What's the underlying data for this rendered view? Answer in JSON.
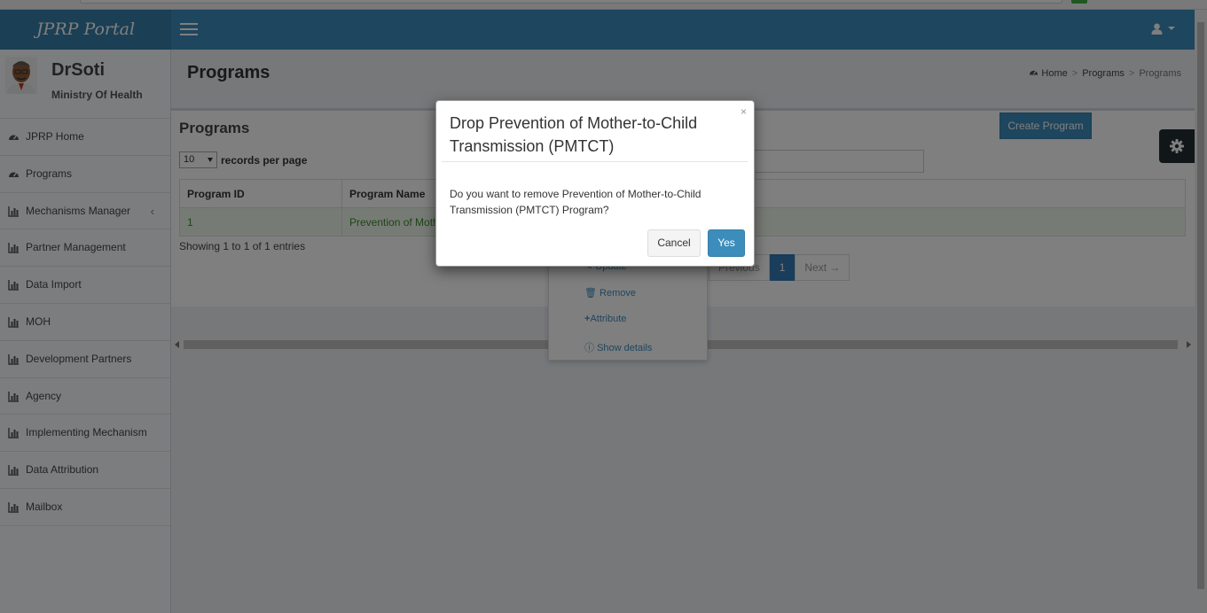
{
  "app": {
    "title": "JPRP Portal"
  },
  "user": {
    "name": "DrSoti",
    "org": "Ministry Of Health"
  },
  "sidebar": {
    "items": [
      {
        "label": "JPRP Home",
        "icon": "dashboard-icon"
      },
      {
        "label": "Programs",
        "icon": "dashboard-icon"
      },
      {
        "label": "Mechanisms Manager",
        "icon": "bar-chart-icon",
        "expandable": true
      },
      {
        "label": "Partner Management",
        "icon": "bar-chart-icon"
      },
      {
        "label": "Data Import",
        "icon": "bar-chart-icon"
      },
      {
        "label": "MOH",
        "icon": "bar-chart-icon"
      },
      {
        "label": "Development Partners",
        "icon": "bar-chart-icon"
      },
      {
        "label": "Agency",
        "icon": "bar-chart-icon"
      },
      {
        "label": "Implementing Mechanism",
        "icon": "bar-chart-icon"
      },
      {
        "label": "Data Attribution",
        "icon": "bar-chart-icon"
      },
      {
        "label": "Mailbox",
        "icon": "bar-chart-icon"
      }
    ]
  },
  "page": {
    "title": "Programs",
    "breadcrumb": {
      "home": "Home",
      "programs": "Programs",
      "current": "Programs"
    }
  },
  "box": {
    "title": "Programs",
    "create_label": "Create Program",
    "page_length": "10",
    "records_label": "records per page",
    "columns": [
      "Program ID",
      "Program Name"
    ],
    "rows": [
      {
        "id": "1",
        "name": "Prevention of Moth"
      }
    ],
    "info": "Showing 1 to 1 of 1 entries",
    "pager": {
      "previous": "Previous",
      "current": "1",
      "next": "Next →"
    }
  },
  "dropdown": {
    "items": [
      {
        "label": "Update",
        "icon": "edit-icon"
      },
      {
        "label": "Remove",
        "icon": "trash-icon"
      },
      {
        "label": "Attribute",
        "icon": "plus-icon"
      },
      {
        "label": "Show details",
        "icon": "info-icon"
      }
    ]
  },
  "modal": {
    "title": "Drop Prevention of Mother-to-Child Transmission (PMTCT)",
    "close": "×",
    "body": "Do you want to remove Prevention of Mother-to-Child Transmission (PMTCT) Program?",
    "cancel": "Cancel",
    "yes": "Yes"
  },
  "colors": {
    "accent": "#3c8dbc",
    "logo_bg": "#367fa9",
    "sidebar_bg": "#f9fafc",
    "row_text": "#3c8d2f"
  }
}
